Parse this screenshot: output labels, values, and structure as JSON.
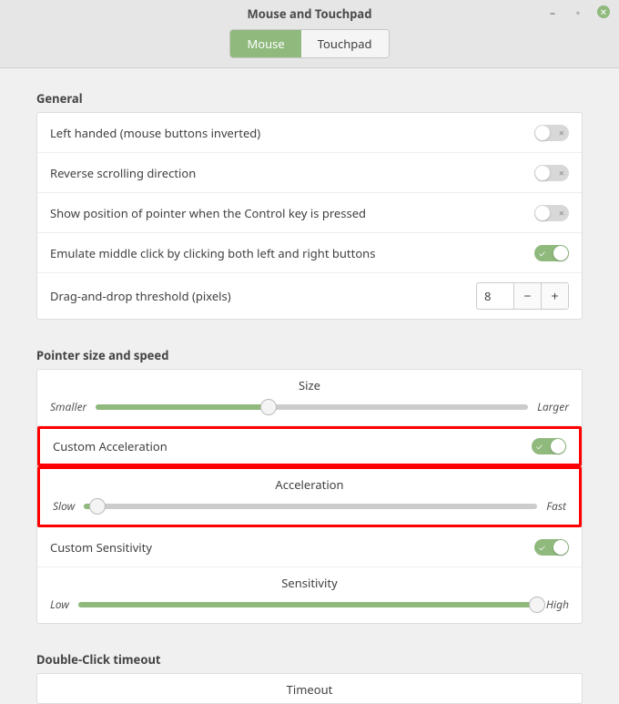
{
  "window": {
    "title": "Mouse and Touchpad",
    "tabs": {
      "mouse": "Mouse",
      "touchpad": "Touchpad"
    }
  },
  "general": {
    "heading": "General",
    "left_handed": {
      "label": "Left handed (mouse buttons inverted)",
      "on": false
    },
    "reverse_scroll": {
      "label": "Reverse scrolling direction",
      "on": false
    },
    "show_position": {
      "label": "Show position of pointer when the Control key is pressed",
      "on": false
    },
    "emulate_middle": {
      "label": "Emulate middle click by clicking both left and right buttons",
      "on": true
    },
    "dnd_threshold": {
      "label": "Drag-and-drop threshold (pixels)",
      "value": "8"
    }
  },
  "pointer": {
    "heading": "Pointer size and speed",
    "size": {
      "title": "Size",
      "min": "Smaller",
      "max": "Larger",
      "pos": 40
    },
    "custom_accel": {
      "label": "Custom Acceleration",
      "on": true
    },
    "accel": {
      "title": "Acceleration",
      "min": "Slow",
      "max": "Fast",
      "pos": 3
    },
    "custom_sens": {
      "label": "Custom Sensitivity",
      "on": true
    },
    "sens": {
      "title": "Sensitivity",
      "min": "Low",
      "max": "High",
      "pos": 100
    }
  },
  "doubleclick": {
    "heading": "Double-Click timeout",
    "timeout_title": "Timeout"
  }
}
